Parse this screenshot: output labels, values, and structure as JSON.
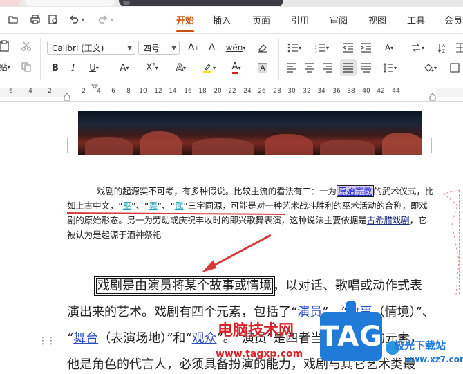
{
  "menu": {
    "tabs": [
      "开始",
      "插入",
      "页面",
      "引用",
      "审阅",
      "视图",
      "工具",
      "会员"
    ],
    "active": "开始"
  },
  "ribbon": {
    "font_name": "Calibri (正文)",
    "font_size": "四号"
  },
  "ruler": {
    "labels": [
      "6",
      "4",
      "2",
      "2",
      "4",
      "6",
      "8",
      "10",
      "12",
      "14",
      "16",
      "18",
      "20",
      "22",
      "24",
      "26",
      "28",
      "30",
      "32",
      "34",
      "36",
      "38",
      "40",
      "42",
      "44"
    ]
  },
  "doc": {
    "para1": {
      "t1": "戏剧的起源实不可考，有多种假说。比较主流的看法有二：一为",
      "link1": "原始宗教",
      "t2": "的武术仪式，比如上古中文，“",
      "link2": "巫",
      "t3": "”、“",
      "link3": "舞",
      "t4": "”、“",
      "link4": "武",
      "t5": "”三字同源，可能是对一种艺术战斗胜利的巫术活动的合称，即戏剧的原始形态。另一为劳动或庆祝丰收时的即兴歌舞表演，这种说法主要依据是",
      "link5": "古希腊戏剧",
      "t6": "，它被认为是起源于酒神祭祀"
    },
    "para2": {
      "boxed": "戏剧是由演员将某个故事或情境",
      "t1": "，以对话、歌唱或动作式表",
      "t2": "演出来的艺术。",
      "t3": "戏剧有四个元素，包括了“",
      "link1": "演员",
      "t4": "”、“",
      "link2": "故事",
      "t5": "（情境）”、",
      "t6": "“",
      "link3": "舞台",
      "t7": "（表演场地）”和“",
      "link4": "观众",
      "t8": "”。“演员”是四者当中最重要的元素，",
      "t9": "他是角色的代言人，必须具备扮演的能力，戏剧与其它艺术类最"
    }
  },
  "watermark": {
    "brand": "电脑技术网",
    "url": "www.tagxp.com",
    "tag": "TAG",
    "site": "极光下载站",
    "site_url": "www.xz7.com"
  },
  "colors": {
    "accent": "#c9520b",
    "annotation": "#d63b3b"
  }
}
